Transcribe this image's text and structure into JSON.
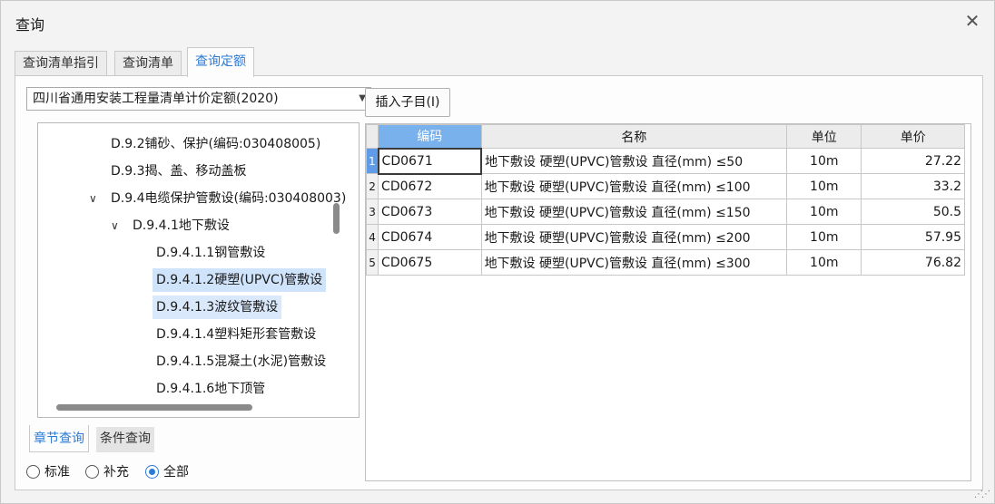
{
  "window": {
    "title": "查询",
    "close_icon": "close-icon"
  },
  "tabs": [
    {
      "label": "查询清单指引"
    },
    {
      "label": "查询清单"
    },
    {
      "label": "查询定额",
      "active": true
    }
  ],
  "quota_library": {
    "selected": "四川省通用安装工程量清单计价定额(2020)"
  },
  "toolbar": {
    "insert_child": "插入子目(I)"
  },
  "tree": {
    "items": [
      {
        "label": "D.9.2铺砂、保护(编码:030408005)",
        "level": 2,
        "expander": ""
      },
      {
        "label": "D.9.3揭、盖、移动盖板",
        "level": 2,
        "expander": ""
      },
      {
        "label": "D.9.4电缆保护管敷设(编码:030408003)",
        "level": 2,
        "expander": "∨"
      },
      {
        "label": "D.9.4.1地下敷设",
        "level": 3,
        "expander": "∨"
      },
      {
        "label": "D.9.4.1.1钢管敷设",
        "level": 4,
        "expander": ""
      },
      {
        "label": "D.9.4.1.2硬塑(UPVC)管敷设",
        "level": 4,
        "expander": "",
        "selected": true
      },
      {
        "label": "D.9.4.1.3波纹管敷设",
        "level": 4,
        "expander": "",
        "hover": true
      },
      {
        "label": "D.9.4.1.4塑料矩形套管敷设",
        "level": 4,
        "expander": ""
      },
      {
        "label": "D.9.4.1.5混凝土(水泥)管敷设",
        "level": 4,
        "expander": ""
      },
      {
        "label": "D.9.4.1.6地下顶管",
        "level": 4,
        "expander": ""
      }
    ]
  },
  "bottom_tabs": [
    {
      "label": "章节查询",
      "active": true
    },
    {
      "label": "条件查询"
    }
  ],
  "filter": {
    "options": [
      {
        "label": "标准",
        "checked": false
      },
      {
        "label": "补充",
        "checked": false
      },
      {
        "label": "全部",
        "checked": true
      }
    ]
  },
  "grid": {
    "columns": [
      "",
      "编码",
      "名称",
      "单位",
      "单价"
    ],
    "rows": [
      {
        "num": "1",
        "code": "CD0671",
        "name": "地下敷设 硬塑(UPVC)管敷设 直径(mm) ≤50",
        "unit": "10m",
        "price": "27.22"
      },
      {
        "num": "2",
        "code": "CD0672",
        "name": "地下敷设 硬塑(UPVC)管敷设 直径(mm) ≤100",
        "unit": "10m",
        "price": "33.2"
      },
      {
        "num": "3",
        "code": "CD0673",
        "name": "地下敷设 硬塑(UPVC)管敷设 直径(mm) ≤150",
        "unit": "10m",
        "price": "50.5"
      },
      {
        "num": "4",
        "code": "CD0674",
        "name": "地下敷设 硬塑(UPVC)管敷设 直径(mm) ≤200",
        "unit": "10m",
        "price": "57.95"
      },
      {
        "num": "5",
        "code": "CD0675",
        "name": "地下敷设 硬塑(UPVC)管敷设 直径(mm) ≤300",
        "unit": "10m",
        "price": "76.82"
      }
    ]
  },
  "colors": {
    "accent": "#2b7bd6",
    "selection": "#cfe3fb",
    "header_sorted": "#79b1ec"
  }
}
